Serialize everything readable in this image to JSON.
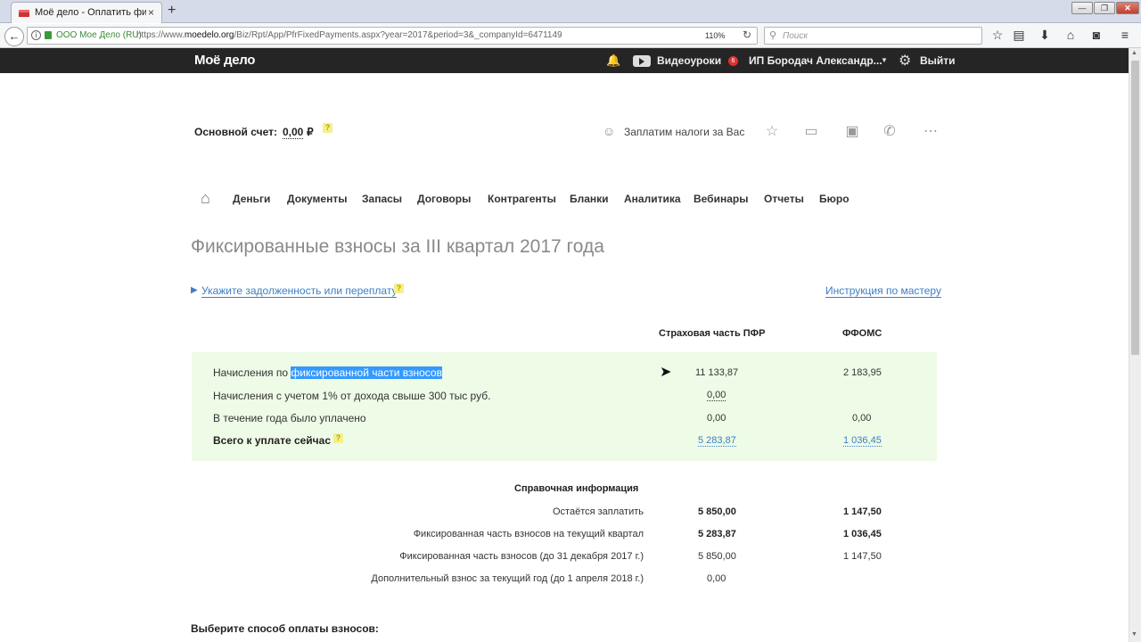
{
  "browser": {
    "tab_title": "Моё дело - Оплатить фикс",
    "tab_close": "×",
    "new_tab": "+",
    "win_min": "—",
    "win_max": "❐",
    "win_close": "✕",
    "back": "←",
    "info": "i",
    "org": "ООО Мое Дело (RU)",
    "url_prefix": "https://www.",
    "url_domain": "moedelo.org",
    "url_path": "/Biz/Rpt/App/PfrFixedPayments.aspx?year=2017&period=3&_companyId=6471149",
    "zoom": "110%",
    "reload": "↻",
    "search_icon": "⚲",
    "search_placeholder": "Поиск",
    "toolbar_icons": [
      "☆",
      "▤",
      "⬇",
      "⌂",
      "◙",
      "≡"
    ]
  },
  "site": {
    "logo": "Моё дело",
    "bell": "🔔",
    "videos": "Видеоуроки",
    "badge_count": "6",
    "user": "ИП Бородач Александр...",
    "caret": "▼",
    "gear": "⚙",
    "logout": "Выйти"
  },
  "account": {
    "label": "Основной счет:",
    "value": "0,00",
    "currency": "₽",
    "help": "?",
    "pay_icon": "☺",
    "pay_text": "Заплатим налоги за Вас",
    "icons": [
      "☆",
      "▭",
      "▣",
      "✆",
      "⋯"
    ]
  },
  "nav": {
    "home": "⌂",
    "items": [
      "Деньги",
      "Документы",
      "Запасы",
      "Договоры",
      "Контрагенты",
      "Бланки",
      "Аналитика",
      "Вебинары",
      "Отчеты",
      "Бюро"
    ]
  },
  "page": {
    "title": "Фиксированные взносы за III квартал 2017 года",
    "debt_tri": "▶",
    "debt_link": "Укажите задолженность или переплату",
    "help": "?",
    "guide_link": "Инструкция по мастеру"
  },
  "table": {
    "col_pfr": "Страховая часть ПФР",
    "col_ffoms": "ФФОМС",
    "row1_prefix": "Начисления по ",
    "row1_hl": "фиксированной части взносов",
    "row1_pfr": "11 133,87",
    "row1_ffoms": "2 183,95",
    "row2_label": "Начисления с учетом 1% от дохода свыше 300 тыс руб.",
    "row2_pfr": "0,00",
    "row3_label": "В течение года было уплачено",
    "row3_pfr": "0,00",
    "row3_ffoms": "0,00",
    "row4_label": "Всего к уплате сейчас",
    "row4_help": "?",
    "row4_pfr": "5 283,87",
    "row4_ffoms": "1 036,45",
    "cursor": "➤"
  },
  "reference": {
    "title": "Справочная информация",
    "rows": [
      {
        "label": "Остаётся заплатить",
        "pfr": "5 850,00",
        "ffoms": "1 147,50"
      },
      {
        "label": "Фиксированная часть взносов на текущий квартал",
        "pfr": "5 283,87",
        "ffoms": "1 036,45"
      },
      {
        "label": "Фиксированная часть взносов (до 31 декабря 2017 г.)",
        "pfr": "5 850,00",
        "ffoms": "1 147,50"
      },
      {
        "label": "Дополнительный взнос за текущий год (до 1 апреля 2018 г.)",
        "pfr": "0,00"
      }
    ]
  },
  "footer": {
    "choose": "Выберите способ оплаты взносов:"
  }
}
